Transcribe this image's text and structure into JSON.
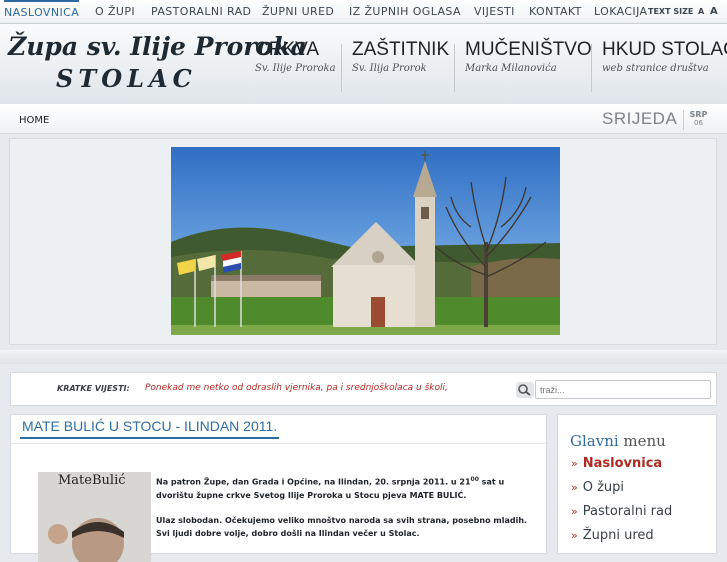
{
  "topnav": {
    "items": [
      "NASLOVNICA",
      "O ŽUPI",
      "PASTORALNI RAD",
      "ŽUPNI URED",
      "IZ ŽUPNIH OGLASA",
      "VIJESTI",
      "KONTAKT",
      "LOKACIJA"
    ],
    "text_size_label": "TEXT SIZE",
    "text_size_small": "A",
    "text_size_large": "A"
  },
  "header": {
    "logo_line1": "Župa sv. Ilije Proroka",
    "logo_line2": "STOLAC",
    "links": [
      {
        "title": "CRKVA",
        "subtitle": "Sv. Ilije Proroka"
      },
      {
        "title": "ZAŠTITNIK",
        "subtitle": "Sv. Ilija Prorok"
      },
      {
        "title": "MUČENIŠTVO",
        "subtitle": "Marka Milanovića"
      },
      {
        "title": "HKUD STOLAC",
        "subtitle": "web stranice društva"
      }
    ]
  },
  "crumbbar": {
    "home": "HOME",
    "day": "SRIJEDA",
    "month": "SRP",
    "date": "06"
  },
  "news": {
    "label": "KRATKE VIJESTI:",
    "text": "Ponekad me netko od odraslih vjernika, pa i srednjoškolaca u školi,",
    "search_placeholder": "traži..."
  },
  "article": {
    "title": "MATE BULIĆ U STOCU - ILINDAN 2011.",
    "image_caption": "MateBulić",
    "para1_a": "Na patron Župe, dan Grada i Općine, na Ilindan, 20. srpnja 2011. u 21",
    "para1_sup": "00",
    "para1_b": " sat u dvorištu župne crkve Svetog Ilije Proroka u Stocu pjeva MATE BULIĆ.",
    "para2": "Ulaz slobodan. Očekujemo veliko mnoštvo naroda sa svih strana, posebno mladih. Svi ljudi dobre volje, dobro došli na Ilindan večer u Stolac."
  },
  "sidemenu": {
    "title_a": "Glavni",
    "title_b": " menu",
    "items": [
      "Naslovnica",
      "O župi",
      "Pastoralni rad",
      "Župni ured"
    ]
  },
  "colors": {
    "accent": "#2e6da4",
    "news_red": "#b02a22"
  }
}
